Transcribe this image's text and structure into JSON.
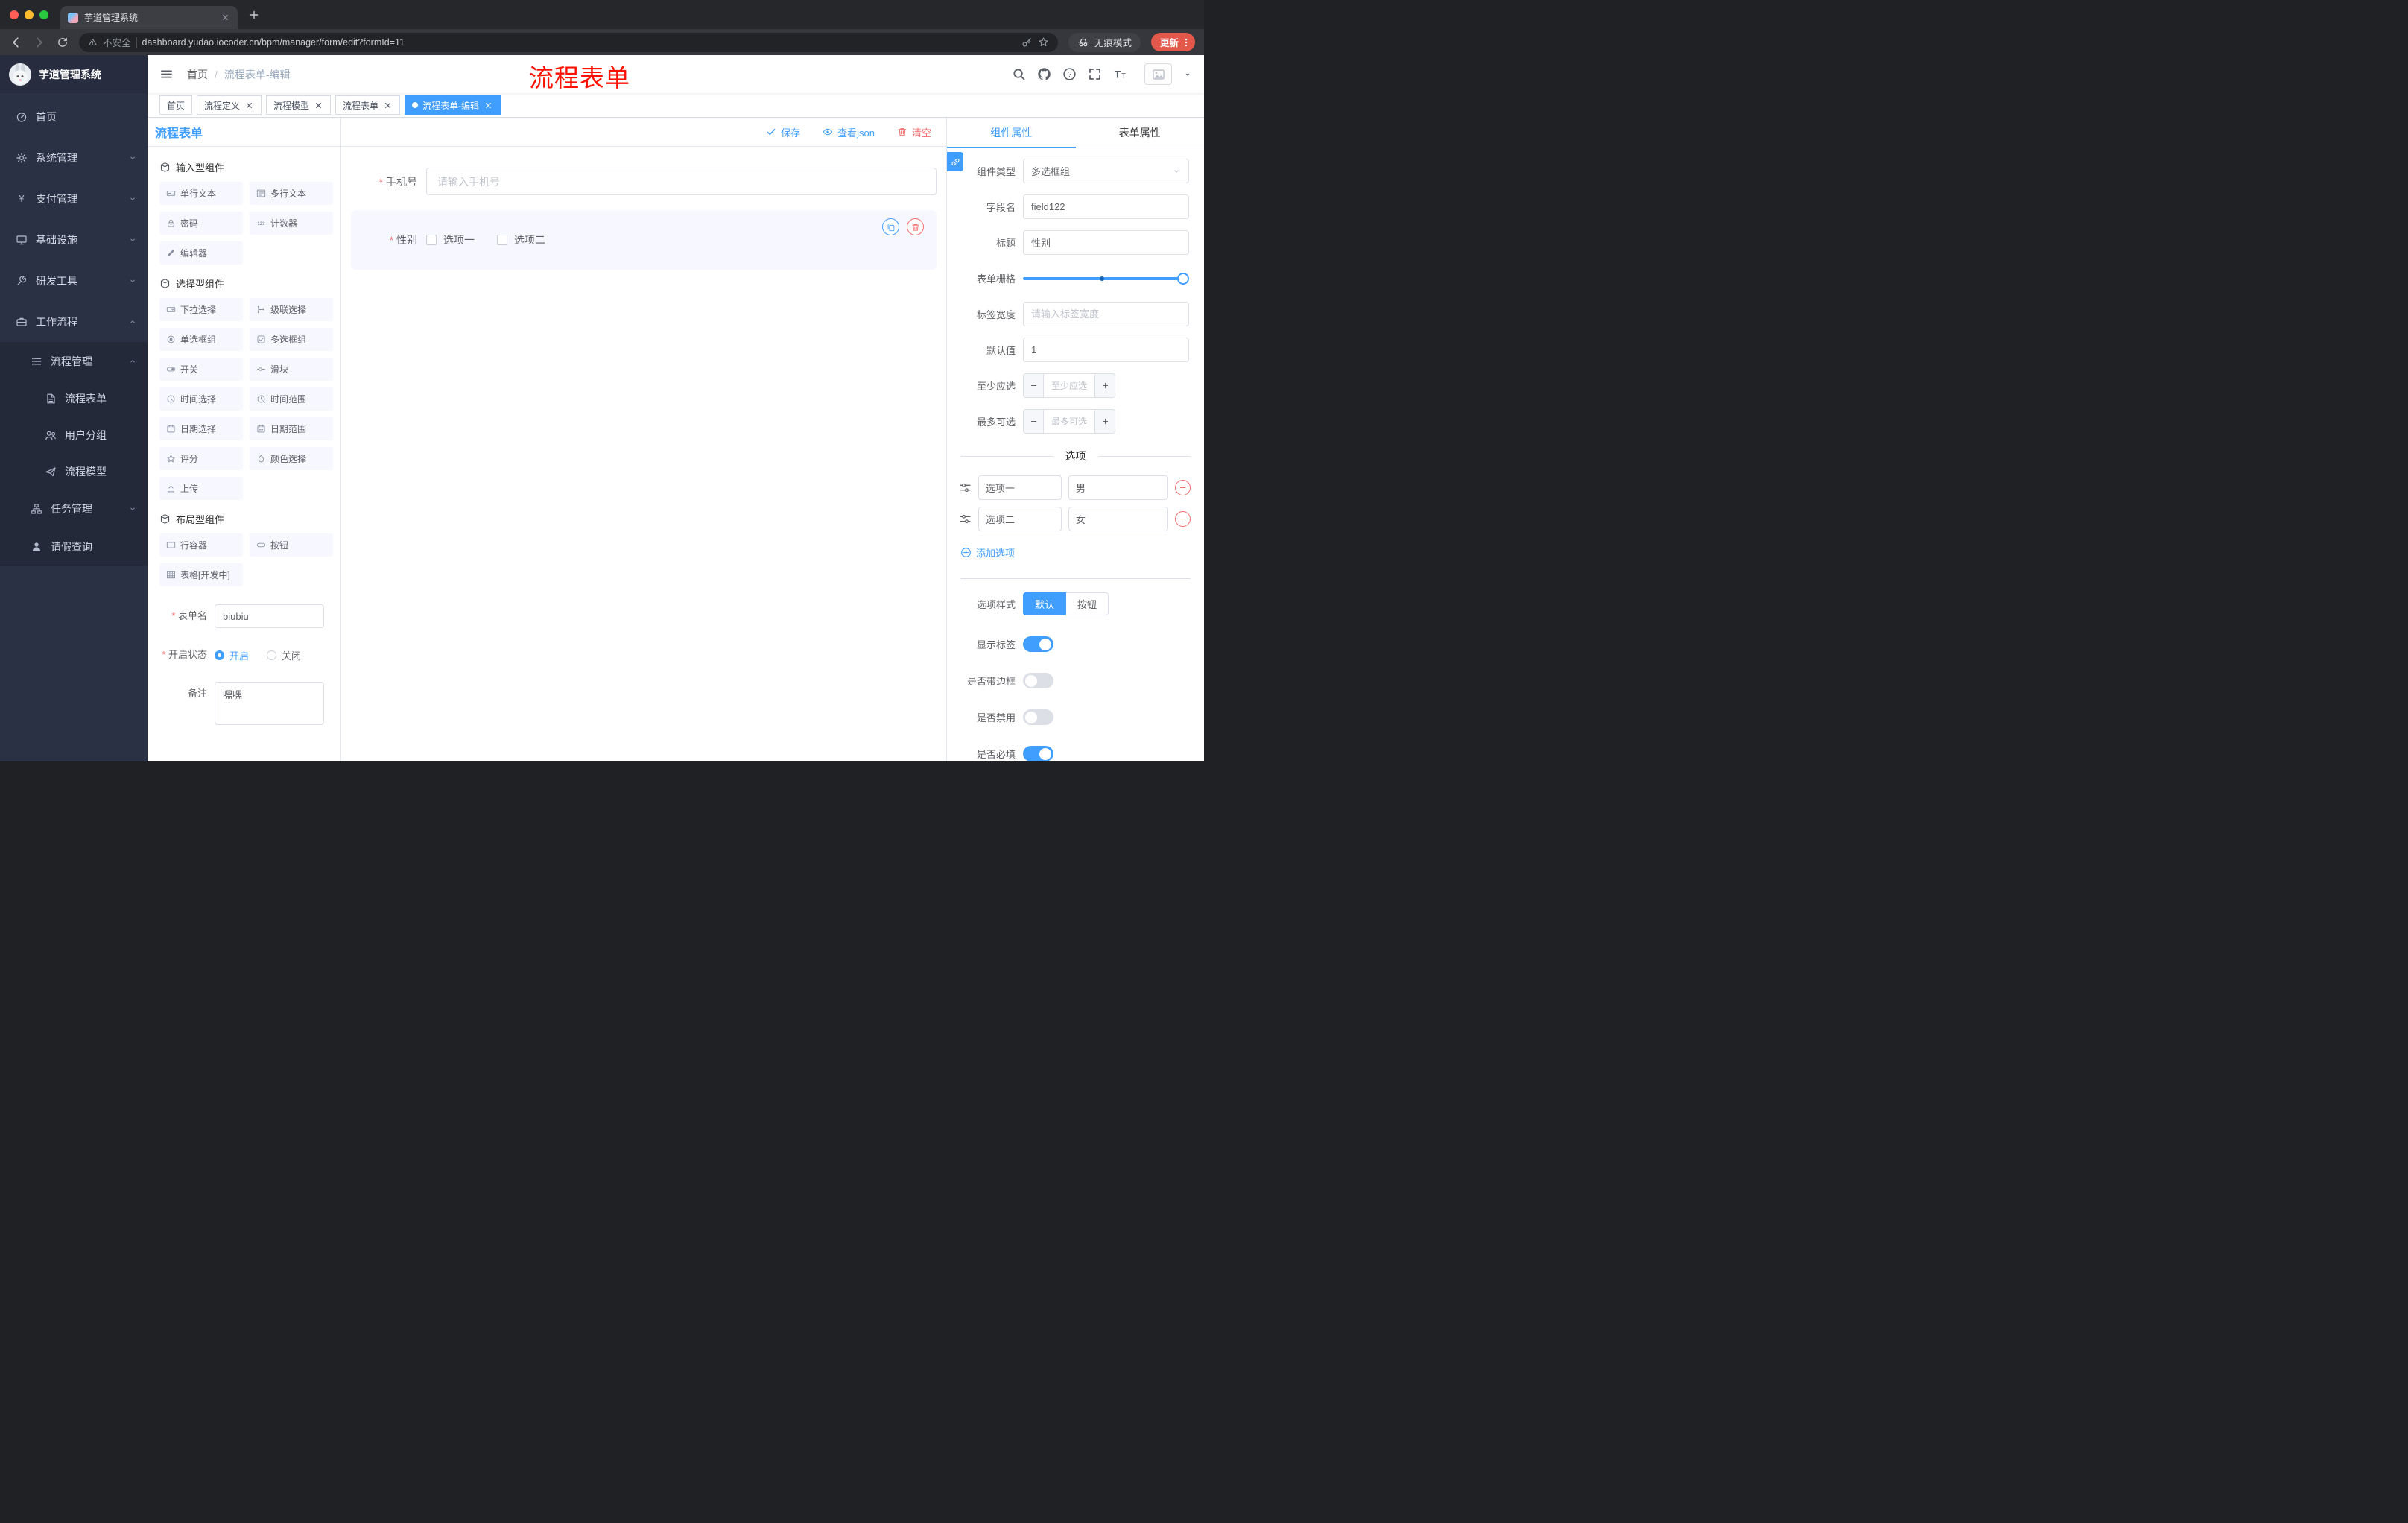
{
  "colors": {
    "primary": "#409EFF",
    "danger": "#F56C6C",
    "annotation": "#FE1100"
  },
  "browser": {
    "tab_title": "芋道管理系统",
    "security_label": "不安全",
    "url": "dashboard.yudao.iocoder.cn/bpm/manager/form/edit?formId=11",
    "incognito_label": "无痕模式",
    "update_label": "更新"
  },
  "annotation": {
    "text": "流程表单"
  },
  "header": {
    "breadcrumb": [
      "首页",
      "流程表单-编辑"
    ]
  },
  "tags": [
    {
      "label": "首页",
      "closable": false,
      "active": false
    },
    {
      "label": "流程定义",
      "closable": true,
      "active": false
    },
    {
      "label": "流程模型",
      "closable": true,
      "active": false
    },
    {
      "label": "流程表单",
      "closable": true,
      "active": false
    },
    {
      "label": "流程表单-编辑",
      "closable": true,
      "active": true
    }
  ],
  "sidebar": {
    "title": "芋道管理系统",
    "menu": [
      {
        "label": "首页",
        "icon": "home-icon",
        "level": 0
      },
      {
        "label": "系统管理",
        "icon": "gear-icon",
        "level": 0,
        "arrow": "down"
      },
      {
        "label": "支付管理",
        "icon": "payment-icon",
        "level": 0,
        "arrow": "down"
      },
      {
        "label": "基础设施",
        "icon": "infra-icon",
        "level": 0,
        "arrow": "down"
      },
      {
        "label": "研发工具",
        "icon": "devtools-icon",
        "level": 0,
        "arrow": "down"
      },
      {
        "label": "工作流程",
        "icon": "workflow-icon",
        "level": 0,
        "arrow": "up"
      },
      {
        "label": "流程管理",
        "icon": "process-list-icon",
        "level": 1,
        "arrow": "up"
      },
      {
        "label": "流程表单",
        "icon": "form-doc-icon",
        "level": 2
      },
      {
        "label": "用户分组",
        "icon": "user-group-icon",
        "level": 2
      },
      {
        "label": "流程模型",
        "icon": "plane-icon",
        "level": 2
      },
      {
        "label": "任务管理",
        "icon": "task-tree-icon",
        "level": 1,
        "arrow": "down"
      },
      {
        "label": "请假查询",
        "icon": "person-icon",
        "level": 1
      }
    ]
  },
  "designer": {
    "panel_title": "流程表单",
    "actions": {
      "save": "保存",
      "view_json": "查看json",
      "clear": "清空"
    },
    "component_sections": [
      {
        "title": "输入型组件",
        "items": [
          {
            "label": "单行文本",
            "icon": "input-field-icon"
          },
          {
            "label": "多行文本",
            "icon": "textarea-icon"
          },
          {
            "label": "密码",
            "icon": "password-icon"
          },
          {
            "label": "计数器",
            "icon": "counter-icon"
          },
          {
            "label": "编辑器",
            "icon": "editor-icon"
          }
        ]
      },
      {
        "title": "选择型组件",
        "items": [
          {
            "label": "下拉选择",
            "icon": "select-icon"
          },
          {
            "label": "级联选择",
            "icon": "cascader-icon"
          },
          {
            "label": "单选框组",
            "icon": "radio-group-icon"
          },
          {
            "label": "多选框组",
            "icon": "checkbox-group-icon"
          },
          {
            "label": "开关",
            "icon": "switch-icon"
          },
          {
            "label": "滑块",
            "icon": "slider-icon"
          },
          {
            "label": "时间选择",
            "icon": "time-icon"
          },
          {
            "label": "时间范围",
            "icon": "time-range-icon"
          },
          {
            "label": "日期选择",
            "icon": "date-icon"
          },
          {
            "label": "日期范围",
            "icon": "date-range-icon"
          },
          {
            "label": "评分",
            "icon": "rate-icon"
          },
          {
            "label": "颜色选择",
            "icon": "color-icon"
          },
          {
            "label": "上传",
            "icon": "upload-icon"
          }
        ]
      },
      {
        "title": "布局型组件",
        "items": [
          {
            "label": "行容器",
            "icon": "row-icon"
          },
          {
            "label": "按钮",
            "icon": "button-icon"
          },
          {
            "label": "表格[开发中]",
            "icon": "table-icon"
          }
        ]
      }
    ],
    "meta_form": {
      "form_name": {
        "label": "表单名",
        "required": true,
        "value": "biubiu"
      },
      "status": {
        "label": "开启状态",
        "required": true,
        "options": [
          {
            "label": "开启",
            "checked": true
          },
          {
            "label": "关闭",
            "checked": false
          }
        ]
      },
      "remark": {
        "label": "备注",
        "value": "嘿嘿"
      }
    },
    "canvas": {
      "fields": [
        {
          "label": "手机号",
          "required": true,
          "type": "input",
          "placeholder": "请输入手机号"
        },
        {
          "label": "性别",
          "required": true,
          "type": "checkbox-group",
          "selected": true,
          "options": [
            "选项一",
            "选项二"
          ]
        }
      ]
    }
  },
  "properties": {
    "tabs": [
      {
        "label": "组件属性",
        "active": true
      },
      {
        "label": "表单属性",
        "active": false
      }
    ],
    "fields": {
      "component_type": {
        "label": "组件类型",
        "value": "多选框组"
      },
      "field_name": {
        "label": "字段名",
        "value": "field122"
      },
      "title": {
        "label": "标题",
        "value": "性别"
      },
      "grid": {
        "label": "表单栅格",
        "value": 24,
        "max": 24
      },
      "label_width": {
        "label": "标签宽度",
        "placeholder": "请输入标签宽度"
      },
      "default_value": {
        "label": "默认值",
        "value": "1"
      },
      "min_select": {
        "label": "至少应选",
        "placeholder": "至少应选"
      },
      "max_select": {
        "label": "最多可选",
        "placeholder": "最多可选"
      }
    },
    "options_section": {
      "divider": "选项",
      "add_label": "添加选项",
      "options": [
        {
          "name": "选项一",
          "value": "男"
        },
        {
          "name": "选项二",
          "value": "女"
        }
      ]
    },
    "option_style": {
      "label": "选项样式",
      "choices": [
        {
          "label": "默认",
          "active": true
        },
        {
          "label": "按钮",
          "active": false
        }
      ]
    },
    "switches": [
      {
        "label": "显示标签",
        "on": true
      },
      {
        "label": "是否带边框",
        "on": false
      },
      {
        "label": "是否禁用",
        "on": false
      },
      {
        "label": "是否必填",
        "on": true
      }
    ]
  }
}
